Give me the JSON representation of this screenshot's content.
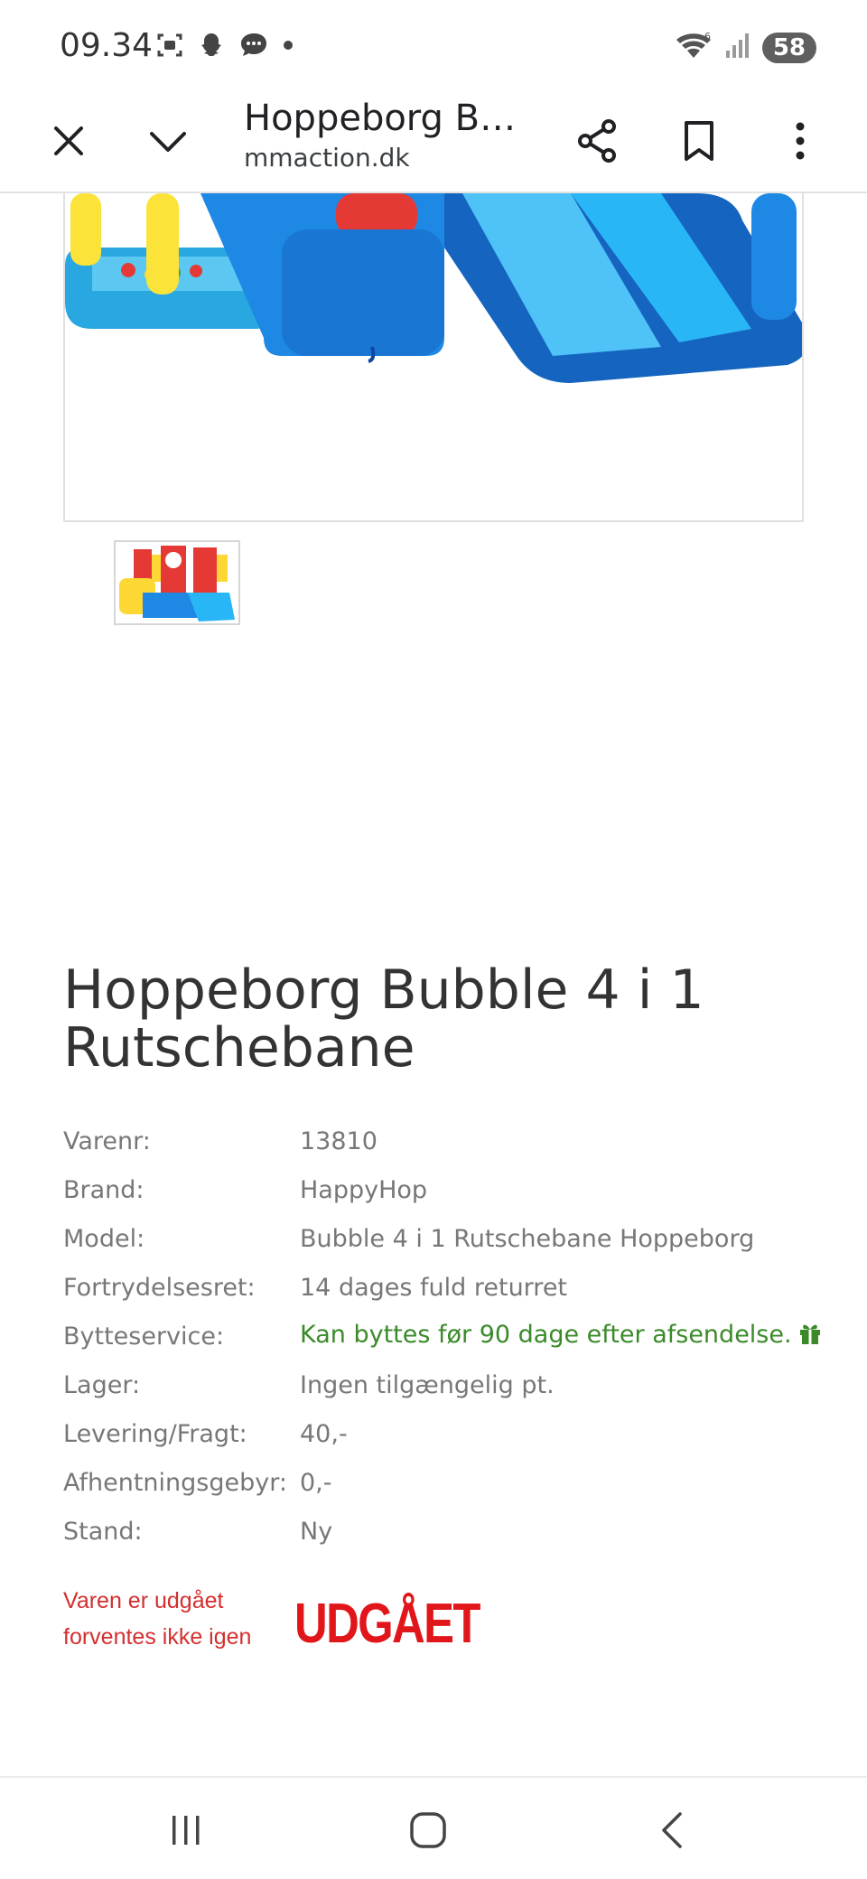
{
  "status_bar": {
    "time": "09.34",
    "battery": "58",
    "wifi_badge": "6"
  },
  "toolbar": {
    "title": "Hoppeborg Bu...",
    "url": "mmaction.dk"
  },
  "product": {
    "title": "Hoppeborg Bubble 4 i 1 Rutschebane",
    "specs": [
      {
        "label": "Varenr:",
        "value": "13810"
      },
      {
        "label": "Brand:",
        "value": "HappyHop"
      },
      {
        "label": "Model:",
        "value": "Bubble 4 i 1 Rutschebane Hoppeborg"
      },
      {
        "label": "Fortrydelsesret:",
        "value": "14 dages fuld returret"
      },
      {
        "label": "Bytteservice:",
        "value": "Kan byttes før 90 dage efter afsendelse."
      },
      {
        "label": "Lager:",
        "value": "Ingen tilgængelig pt."
      },
      {
        "label": "Levering/Fragt:",
        "value": "40,-"
      },
      {
        "label": "Afhentningsgebyr:",
        "value": "0,-"
      },
      {
        "label": "Stand:",
        "value": "Ny"
      }
    ],
    "discontinued_note_line1": "Varen er udgået",
    "discontinued_note_line2": "forventes ikke igen",
    "discontinued_badge": "UDGÅET"
  },
  "colors": {
    "green_text": "#3a8a2a",
    "red_text": "#d32f2f",
    "badge_red": "#e0161b"
  }
}
